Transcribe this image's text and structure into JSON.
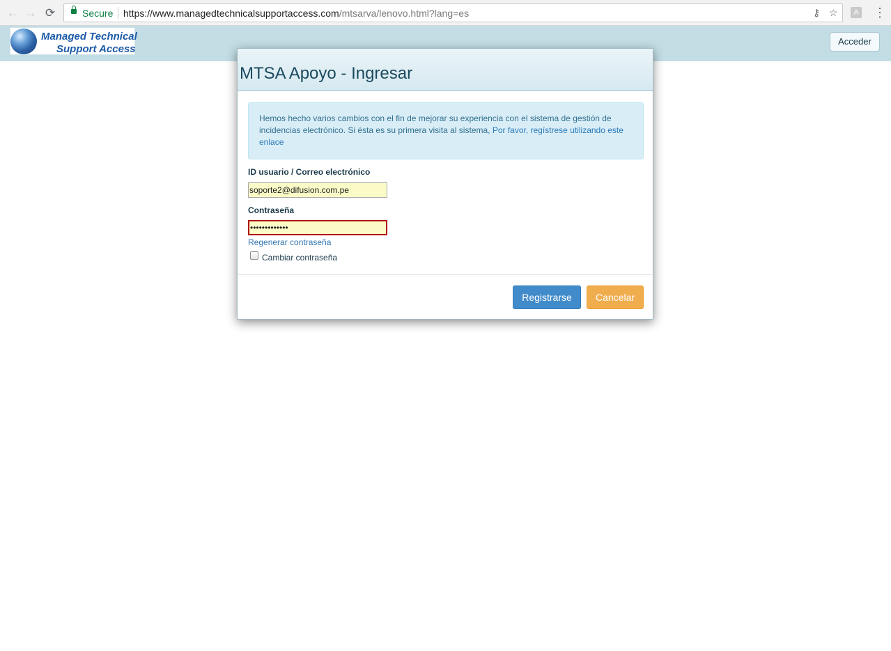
{
  "browser": {
    "back_glyph": "←",
    "forward_glyph": "→",
    "reload_glyph": "⟳",
    "secure_label": "Secure",
    "url_main": "https://www.managedtechnicalsupportaccess.com",
    "url_rest": "/mtsarva/lenovo.html?lang=es",
    "key_icon_glyph": "⚷",
    "star_icon_glyph": "☆",
    "menu_glyph": "⋮",
    "icons": [
      "back-arrow-icon",
      "forward-arrow-icon",
      "reload-icon",
      "lock-icon",
      "key-icon",
      "star-icon",
      "pdf-extension-icon",
      "menu-icon"
    ]
  },
  "header": {
    "logo_line1": "Managed Technical",
    "logo_line2": "Support Access",
    "login_button": "Acceder",
    "background_color": "#c3dde5"
  },
  "modal": {
    "title": "MTSA Apoyo - Ingresar",
    "info": {
      "text": "Hemos hecho varios cambios con el fin de mejorar su experiencia con el sistema de gestión de incidencias electrónico. Si ésta es su primera visita al sistema, ",
      "link": "Por favor, regístrese utilizando este enlace"
    },
    "user_label": "ID usuario / Correo electrónico",
    "user_value": "soporte2@difusion.com.pe",
    "password_label": "Contraseña",
    "password_value": "•••••••••••••",
    "regen_link": "Regenerar contraseña",
    "change_password_label": "Cambiar contraseña",
    "change_password_checked": false,
    "register_button": "Registrarse",
    "cancel_button": "Cancelar",
    "colors": {
      "primary": "#428bca",
      "warning": "#f0ad4e",
      "info_bg": "#d9edf7",
      "input_autofill": "#fbfbc8",
      "error_border": "#b00000"
    }
  }
}
